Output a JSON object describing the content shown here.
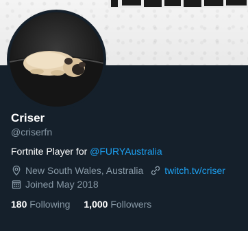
{
  "profile": {
    "name": "Criser",
    "handle": "@criserfn",
    "bio_prefix": "Fortnite Player for ",
    "bio_mention": "@FURYAustralia",
    "location": "New South Wales, Australia",
    "website": "twitch.tv/criser",
    "joined": "Joined May 2018"
  },
  "stats": {
    "following_count": "180",
    "following_label": "Following",
    "followers_count": "1,000",
    "followers_label": "Followers"
  },
  "icons": {
    "location": "location-pin-icon",
    "website": "link-icon",
    "joined": "calendar-icon"
  },
  "colors": {
    "background": "#15202b",
    "link": "#1da1f2",
    "secondary_text": "#8899a6"
  }
}
